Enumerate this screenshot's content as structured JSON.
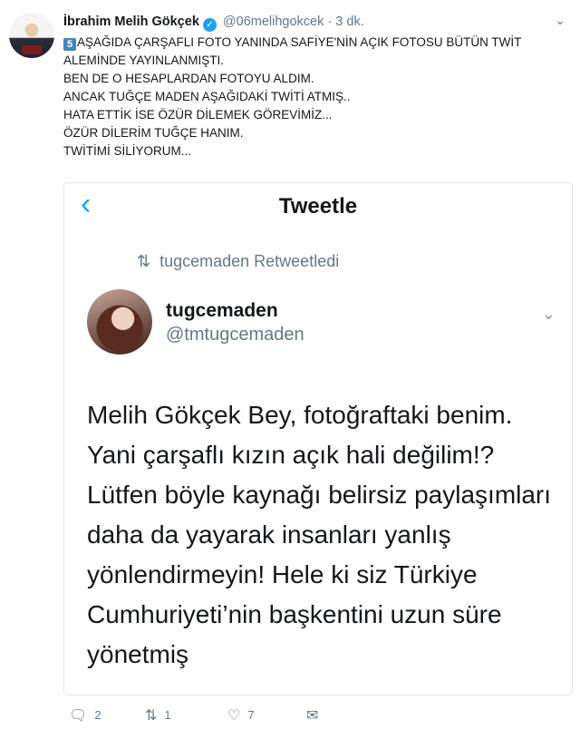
{
  "tweet": {
    "author_name": "İbrahim Melih Gökçek",
    "handle": "@06melihgokcek",
    "separator": "·",
    "time": "3 dk.",
    "keycap": "5",
    "lines": [
      "AŞAĞIDA ÇARŞAFLI FOTO YANINDA SAFİYE'NİN AÇIK FOTOSU BÜTÜN TWİT",
      "ALEMİNDE YAYINLANMIŞTI.",
      "BEN DE O HESAPLARDAN FOTOYU ALDIM.",
      "ANCAK TUĞÇE MADEN AŞAĞIDAKİ TWİTİ ATMIŞ..",
      "HATA ETTİK İSE ÖZÜR DİLEMEK GÖREVİMİZ...",
      "ÖZÜR DİLERİM TUĞÇE HANIM.",
      "TWİTİMİ SİLİYORUM..."
    ]
  },
  "embed": {
    "nav_title": "Tweetle",
    "retweet_by": "tugcemaden Retweetledi",
    "author_name": "tugcemaden",
    "handle": "@tmtugcemaden",
    "text": "Melih Gökçek Bey, fotoğraftaki benim. Yani çarşaflı kızın açık hali değilim!? Lütfen böyle kaynağı belirsiz paylaşımları daha da yayarak insanları yanlış yönlendirmeyin! Hele ki siz Türkiye Cumhuriyeti’nin başkentini uzun süre yönetmiş"
  },
  "actions": {
    "reply_count": "2",
    "retweet_count": "1",
    "like_count": "7"
  },
  "icons": [
    "verified-badge-icon",
    "chevron-down-icon",
    "back-chevron-icon",
    "retweet-icon",
    "reply-icon",
    "like-icon",
    "direct-message-icon"
  ],
  "colors": {
    "accent": "#1da1f2",
    "muted": "#657786",
    "keycap": "#3b88c3"
  }
}
